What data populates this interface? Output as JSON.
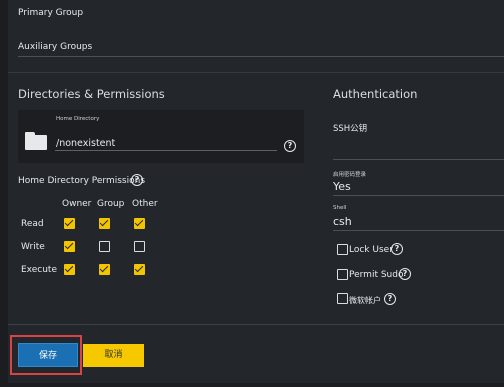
{
  "fields": {
    "primary_group": "Primary Group",
    "auxiliary_groups": "Auxiliary Groups"
  },
  "sections": {
    "directories": "Directories & Permissions",
    "authentication": "Authentication"
  },
  "home_dir": {
    "label": "Home Directory",
    "value": "/nonexistent"
  },
  "permissions": {
    "title": "Home Directory Permissions",
    "columns": [
      "Owner",
      "Group",
      "Other"
    ],
    "rows": [
      {
        "label": "Read",
        "checked": [
          true,
          true,
          true
        ]
      },
      {
        "label": "Write",
        "checked": [
          true,
          false,
          false
        ]
      },
      {
        "label": "Execute",
        "checked": [
          true,
          true,
          true
        ]
      }
    ]
  },
  "auth": {
    "ssh_label": "SSH公钥",
    "password_label": "启用密码登录",
    "password_value": "Yes",
    "shell_label": "Shell",
    "shell_value": "csh",
    "options": [
      "Lock User",
      "Permit Sudo",
      "微软帐户"
    ]
  },
  "buttons": {
    "save": "保存",
    "cancel": "取消"
  },
  "colors": {
    "accent": "#1b6fb3",
    "checkbox": "#f2c500",
    "cancel": "#f5c800",
    "highlight": "#d64545"
  }
}
